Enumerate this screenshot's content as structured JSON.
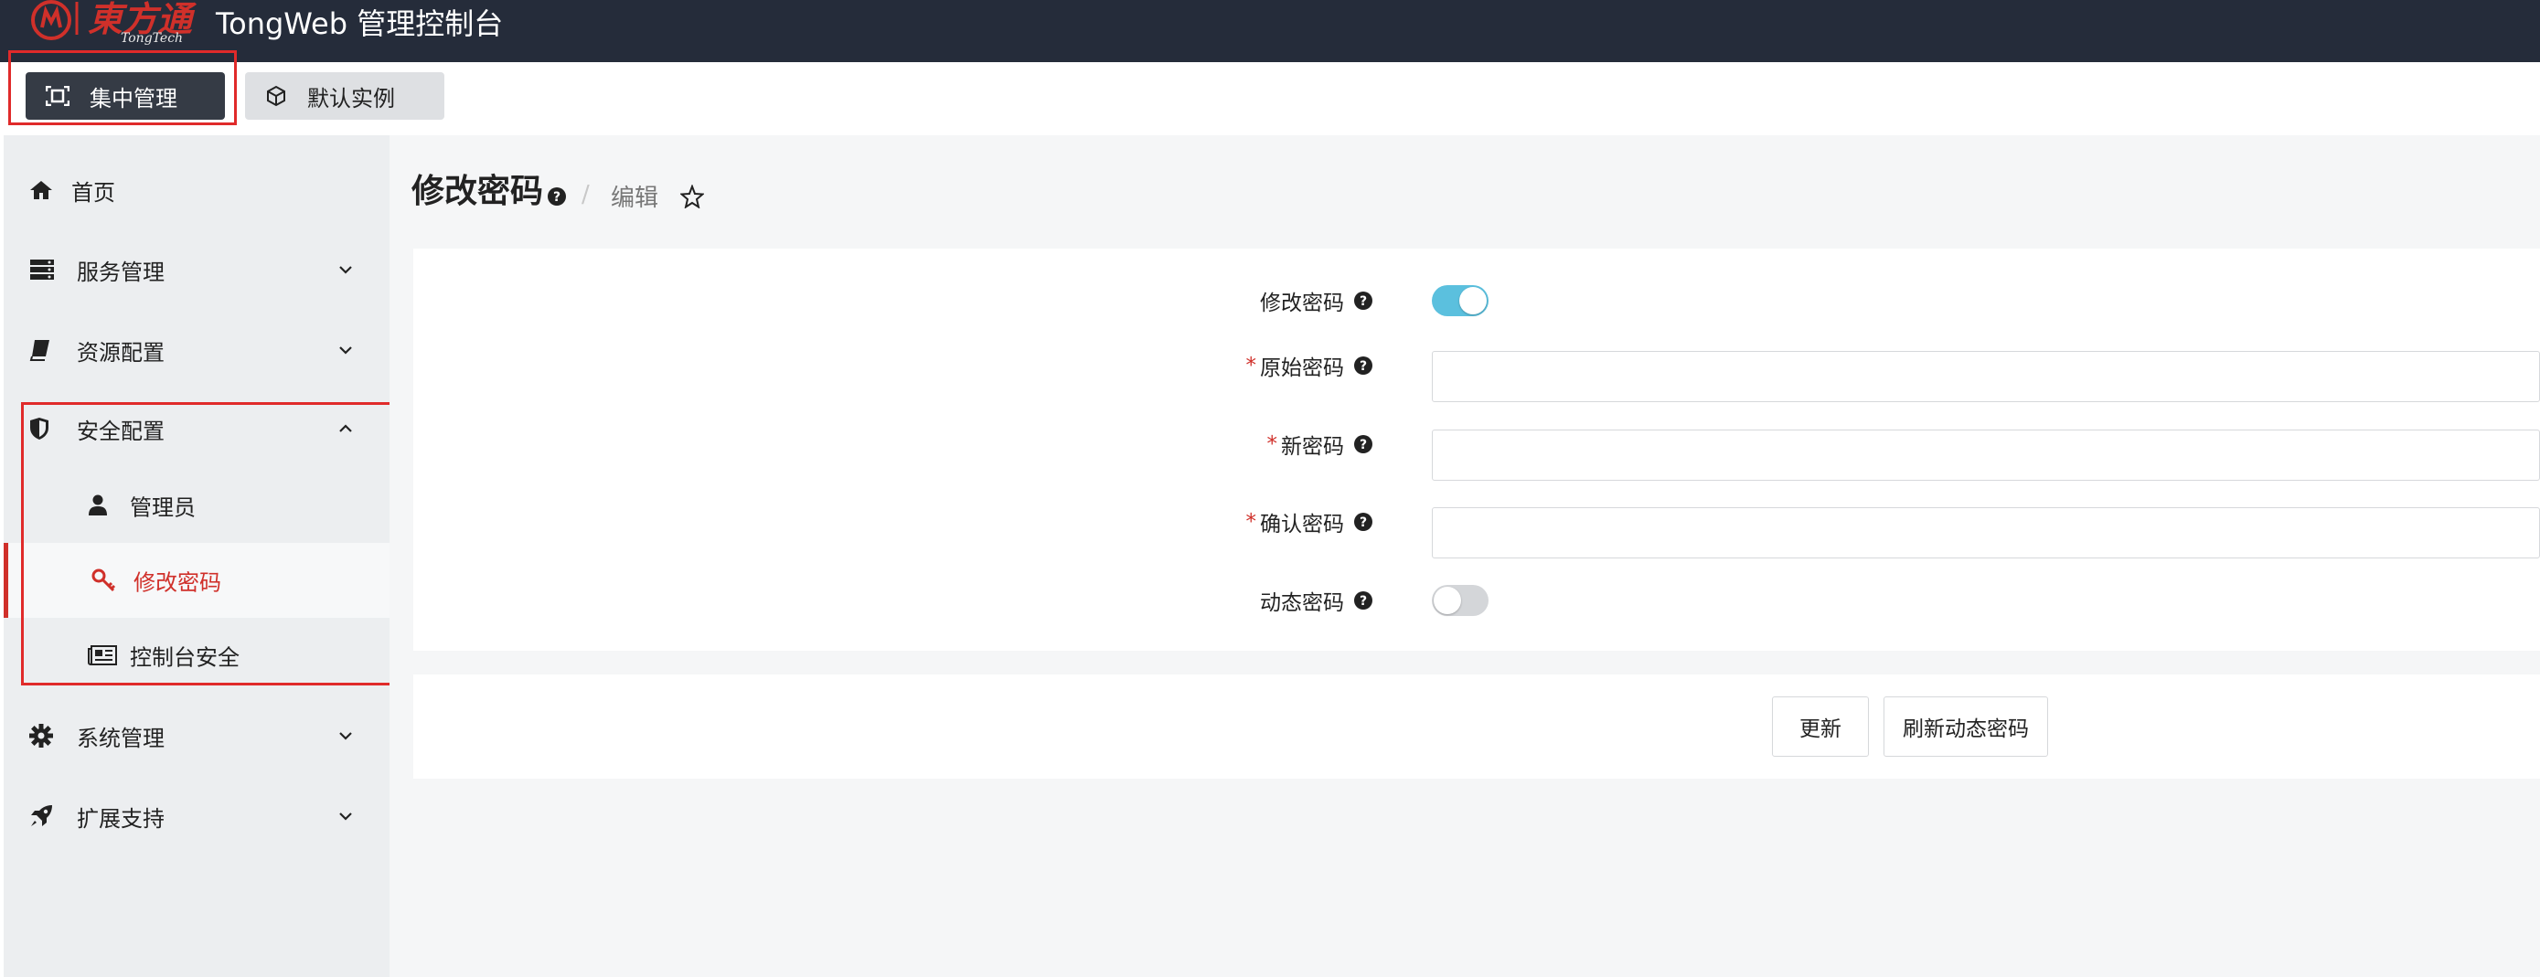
{
  "header": {
    "logo_brand": "東方通",
    "logo_sub": "TongTech",
    "app_title": "TongWeb 管理控制台"
  },
  "tabs": [
    {
      "label": "集中管理",
      "icon": "screen-frame-icon",
      "active": true
    },
    {
      "label": "默认实例",
      "icon": "cube-icon",
      "active": false
    }
  ],
  "sidebar": {
    "items": [
      {
        "label": "首页",
        "icon": "home-icon"
      },
      {
        "label": "服务管理",
        "icon": "server-icon"
      },
      {
        "label": "资源配置",
        "icon": "book-icon"
      },
      {
        "label": "安全配置",
        "icon": "shield-icon",
        "expanded": true
      },
      {
        "label": "系统管理",
        "icon": "gear-icon"
      },
      {
        "label": "扩展支持",
        "icon": "rocket-icon"
      }
    ],
    "security_children": [
      {
        "label": "管理员",
        "icon": "user-icon"
      },
      {
        "label": "修改密码",
        "icon": "key-icon",
        "active": true
      },
      {
        "label": "控制台安全",
        "icon": "newspaper-icon"
      }
    ]
  },
  "page": {
    "title": "修改密码",
    "breadcrumb_sep": "/",
    "breadcrumb_current": "编辑"
  },
  "form": {
    "change_password_label": "修改密码",
    "change_password_enabled": true,
    "old_password_label": "原始密码",
    "old_password_value": "",
    "new_password_label": "新密码",
    "new_password_value": "",
    "confirm_password_label": "确认密码",
    "confirm_password_value": "",
    "dynamic_password_label": "动态密码",
    "dynamic_password_enabled": false,
    "required_mark": "*"
  },
  "buttons": {
    "update": "更新",
    "refresh_dynamic": "刷新动态密码"
  },
  "colors": {
    "accent_red": "#d0302a",
    "toggle_on": "#5bc0de",
    "topbar": "#252c3a"
  }
}
